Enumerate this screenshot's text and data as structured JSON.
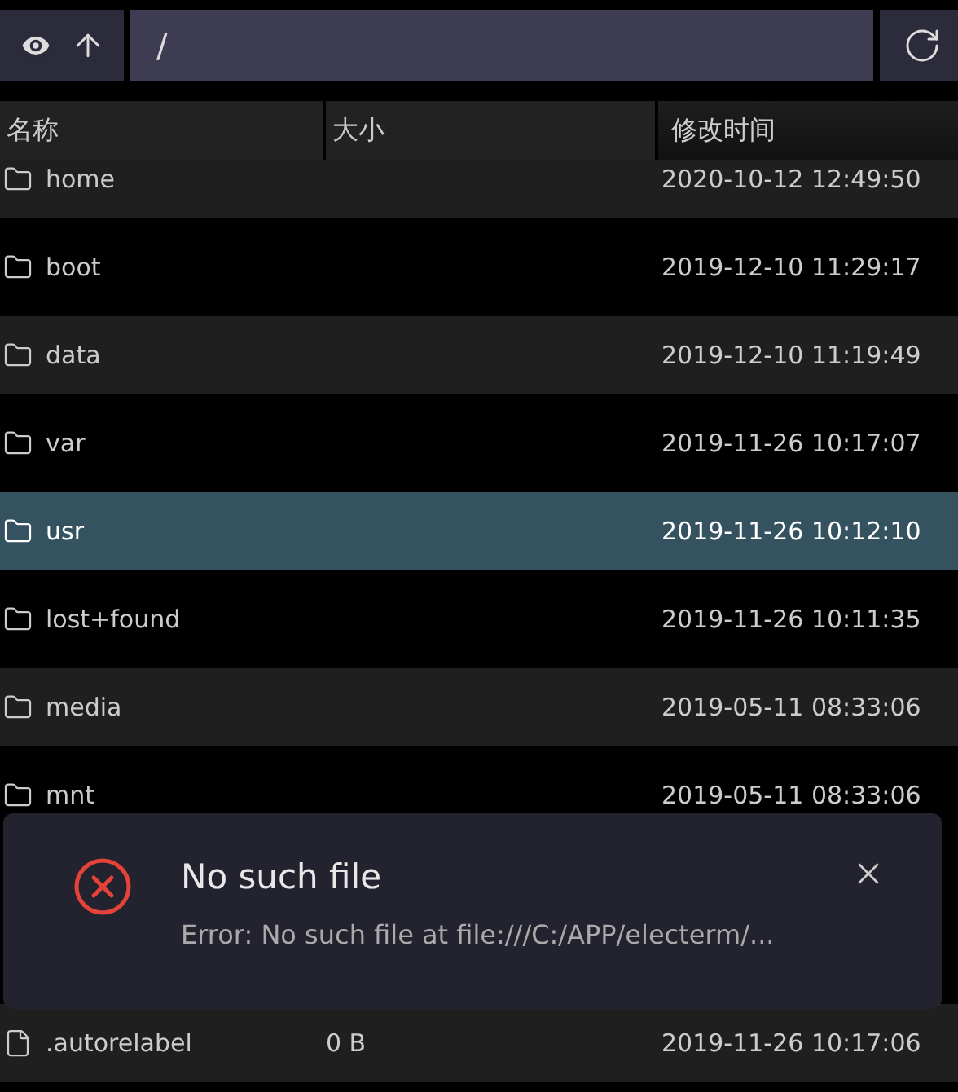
{
  "toolbar": {
    "path": "/"
  },
  "columns": [
    "名称",
    "大小",
    "修改时间"
  ],
  "rows": [
    {
      "kind": "folder",
      "name": "home",
      "modified": "2020-10-12 12:49:50",
      "selected": false
    },
    {
      "kind": "folder",
      "name": "boot",
      "modified": "2019-12-10 11:29:17",
      "selected": false
    },
    {
      "kind": "folder",
      "name": "data",
      "modified": "2019-12-10 11:19:49",
      "selected": false
    },
    {
      "kind": "folder",
      "name": "var",
      "modified": "2019-11-26 10:17:07",
      "selected": false
    },
    {
      "kind": "folder",
      "name": "usr",
      "modified": "2019-11-26 10:12:10",
      "selected": true
    },
    {
      "kind": "folder",
      "name": "lost+found",
      "modified": "2019-11-26 10:11:35",
      "selected": false
    },
    {
      "kind": "folder",
      "name": "media",
      "modified": "2019-05-11 08:33:06",
      "selected": false
    },
    {
      "kind": "folder",
      "name": "mnt",
      "modified": "2019-05-11 08:33:06",
      "selected": false
    }
  ],
  "bottom_rows": [
    {
      "kind": "file",
      "name": ".autorelabel",
      "size": "0 B",
      "modified": "2019-11-26 10:17:06",
      "selected": false
    }
  ],
  "notification": {
    "title": "No such file",
    "message": "Error: No such file at file:///C:/APP/electerm/..."
  }
}
